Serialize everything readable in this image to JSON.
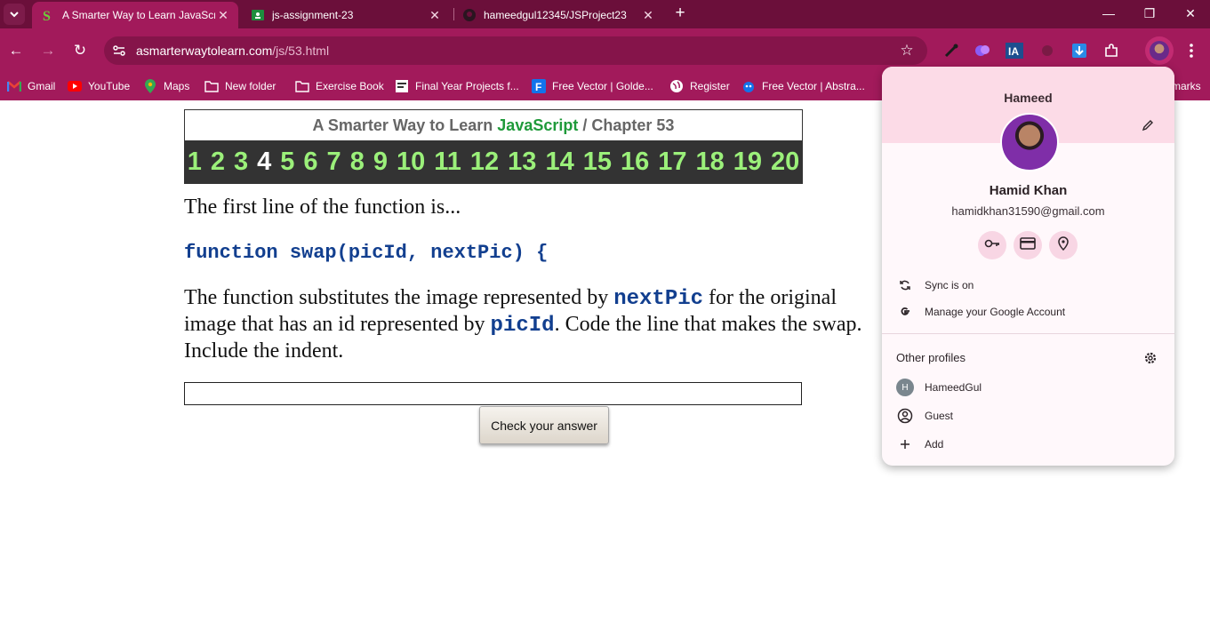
{
  "colors": {
    "tabstrip": "#6b0f3a",
    "toolbar": "#a21a5b",
    "pager_bg": "#333333",
    "pager_link": "#9bf07a",
    "js_green": "#1f9a3a",
    "code_blue": "#123f8f",
    "popup_banner": "#fcdbe7"
  },
  "tabs": [
    {
      "title": "A Smarter Way to Learn JavaScr",
      "icon": "s-logo-icon",
      "active": true
    },
    {
      "title": "js-assignment-23",
      "icon": "google-classroom-icon",
      "active": false
    },
    {
      "title": "hameedgul12345/JSProject23",
      "icon": "github-icon",
      "active": false
    }
  ],
  "omnibox": {
    "host": "asmarterwaytolearn.com",
    "path": "/js/53.html"
  },
  "bookmarks": [
    {
      "label": "Gmail",
      "icon": "gmail-icon"
    },
    {
      "label": "YouTube",
      "icon": "youtube-icon"
    },
    {
      "label": "Maps",
      "icon": "maps-icon"
    },
    {
      "label": "New folder",
      "icon": "folder-icon"
    },
    {
      "label": "Exercise Book",
      "icon": "folder-icon"
    },
    {
      "label": "Final Year Projects f...",
      "icon": "page-icon"
    },
    {
      "label": "Free Vector | Golde...",
      "icon": "freepik-icon"
    },
    {
      "label": "Register",
      "icon": "globe-icon"
    },
    {
      "label": "Free Vector | Abstra...",
      "icon": "freepik-icon"
    },
    {
      "label": "marks",
      "icon": "all-bookmarks-icon"
    }
  ],
  "page": {
    "title_prefix": "A Smarter Way to Learn",
    "title_js": "JavaScript",
    "title_sep": "/",
    "title_chapter": "Chapter 53",
    "pages": [
      "1",
      "2",
      "3",
      "4",
      "5",
      "6",
      "7",
      "8",
      "9",
      "10",
      "11",
      "12",
      "13",
      "14",
      "15",
      "16",
      "17",
      "18",
      "19",
      "20"
    ],
    "current_page": "4",
    "intro": "The first line of the function is...",
    "code_line": "function swap(picId, nextPic) {",
    "q_part1": "The function substitutes the image represented by ",
    "q_code1": "nextPic",
    "q_part2": " for the original image that has an id represented by ",
    "q_code2": "picId",
    "q_part3": ". Code the line that makes the swap. Include the indent.",
    "answer_value": "",
    "check_label": "Check your answer"
  },
  "profile": {
    "profile_name": "Hameed",
    "full_name": "Hamid Khan",
    "email": "hamidkhan31590@gmail.com",
    "quick_actions": [
      "password-key-icon",
      "payment-card-icon",
      "address-pin-icon"
    ],
    "sync_label": "Sync is on",
    "manage_label": "Manage your Google Account",
    "other_profiles_label": "Other profiles",
    "profiles": [
      {
        "label": "HameedGul",
        "letter": "H"
      },
      {
        "label": "Guest",
        "icon": "guest-icon"
      },
      {
        "label": "Add",
        "icon": "add-icon"
      }
    ]
  }
}
